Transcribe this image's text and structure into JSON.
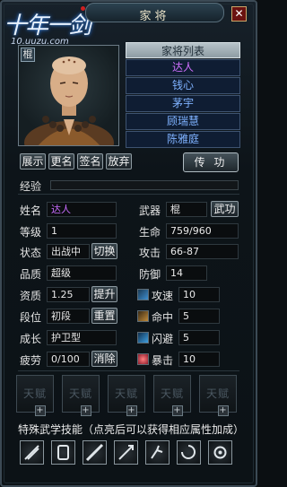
{
  "window": {
    "title": "家将",
    "close": "✕"
  },
  "logo": {
    "text": "十年一剑",
    "url": "10.uuzu.com"
  },
  "portrait": {
    "badge": "棍"
  },
  "general_list": {
    "header": "家将列表",
    "items": [
      {
        "label": "达人",
        "selected": true
      },
      {
        "label": "钱心",
        "selected": false
      },
      {
        "label": "茅宇",
        "selected": false
      },
      {
        "label": "顾瑞慧",
        "selected": false
      },
      {
        "label": "陈雅庭",
        "selected": false
      }
    ]
  },
  "actions": {
    "show": "展示",
    "rename": "更名",
    "sign": "签名",
    "release": "放弃",
    "transfer": "传 功"
  },
  "exp": {
    "label": "经验",
    "progress": 0.0
  },
  "stats": {
    "name_label": "姓名",
    "name": "达人",
    "weapon_label": "武器",
    "weapon": "棍",
    "weapon_btn": "武功",
    "level_label": "等级",
    "level": "1",
    "hp_label": "生命",
    "hp": "759/960",
    "status_label": "状态",
    "status": "出战中",
    "status_btn": "切换",
    "attack_label": "攻击",
    "attack": "66-87",
    "quality_label": "品质",
    "quality": "超级",
    "defense_label": "防御",
    "defense": "14",
    "aptitude_label": "资质",
    "aptitude": "1.25",
    "aptitude_btn": "提升",
    "atkspeed_label": "攻速",
    "atkspeed": "10",
    "stage_label": "段位",
    "stage": "初段",
    "stage_btn": "重置",
    "hit_label": "命中",
    "hit": "5",
    "growth_label": "成长",
    "growth": "护卫型",
    "dodge_label": "闪避",
    "dodge": "5",
    "fatigue_label": "疲劳",
    "fatigue": "0/100",
    "fatigue_btn": "消除",
    "crit_label": "暴击",
    "crit": "10"
  },
  "talents": {
    "label": "天赋",
    "plus": "+"
  },
  "skills": {
    "title": "特殊武学技能（点亮后可以获得相应属性加成）"
  },
  "colors": {
    "selected_name": "#d070ff",
    "list_text": "#7fb2ff",
    "name_value": "#c86cff"
  }
}
